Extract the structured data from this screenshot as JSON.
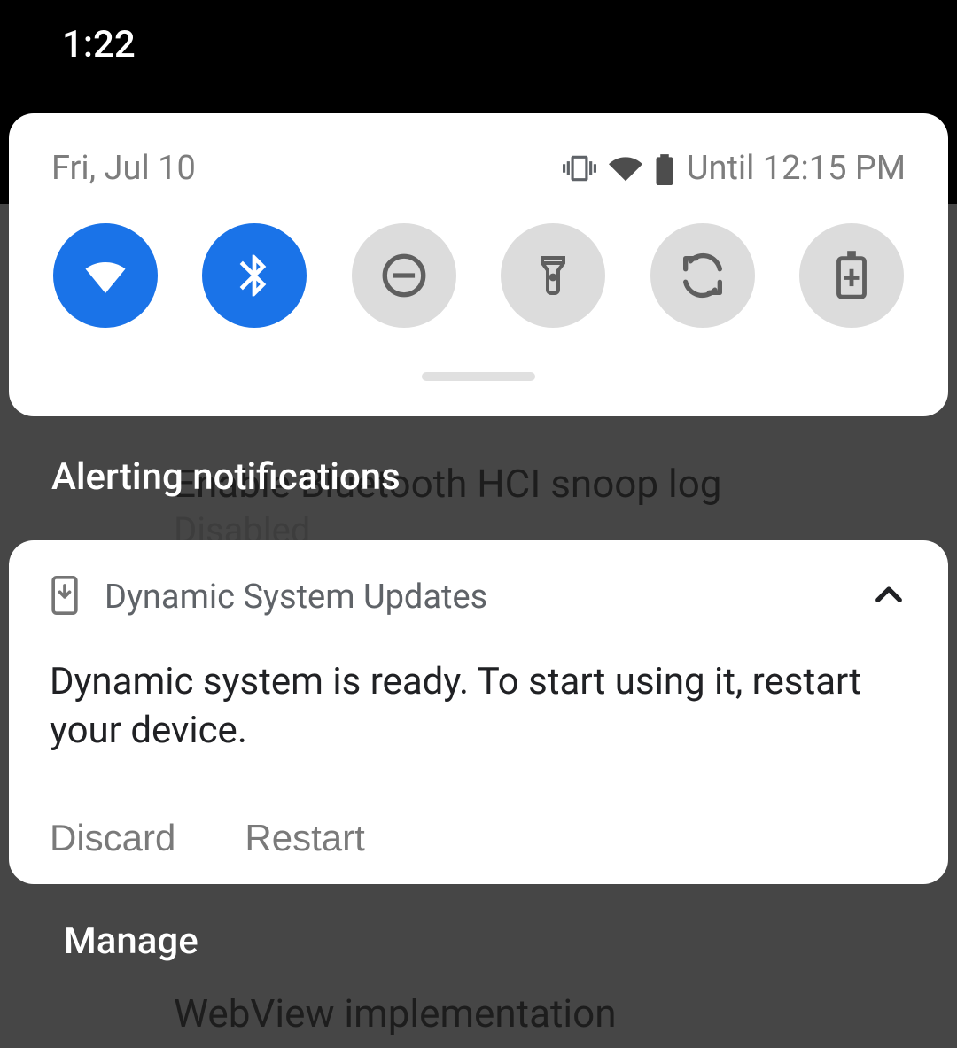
{
  "status": {
    "time": "1:22"
  },
  "qs": {
    "date": "Fri, Jul 10",
    "alarm_text": "Until 12:15 PM",
    "tiles": [
      {
        "name": "wifi",
        "active": true
      },
      {
        "name": "bluetooth",
        "active": true
      },
      {
        "name": "dnd",
        "active": false
      },
      {
        "name": "flashlight",
        "active": false
      },
      {
        "name": "autorotate",
        "active": false
      },
      {
        "name": "battery-saver",
        "active": false
      }
    ]
  },
  "section": {
    "alerting": "Alerting notifications"
  },
  "notification": {
    "app": "Dynamic System Updates",
    "body": "Dynamic system is ready. To start using it, restart your device.",
    "actions": {
      "discard": "Discard",
      "restart": "Restart"
    }
  },
  "footer": {
    "manage": "Manage"
  },
  "background": {
    "item1_title": "Enable Bluetooth HCI snoop log",
    "item1_sub": "Disabled",
    "item2_title": "WebView implementation"
  }
}
